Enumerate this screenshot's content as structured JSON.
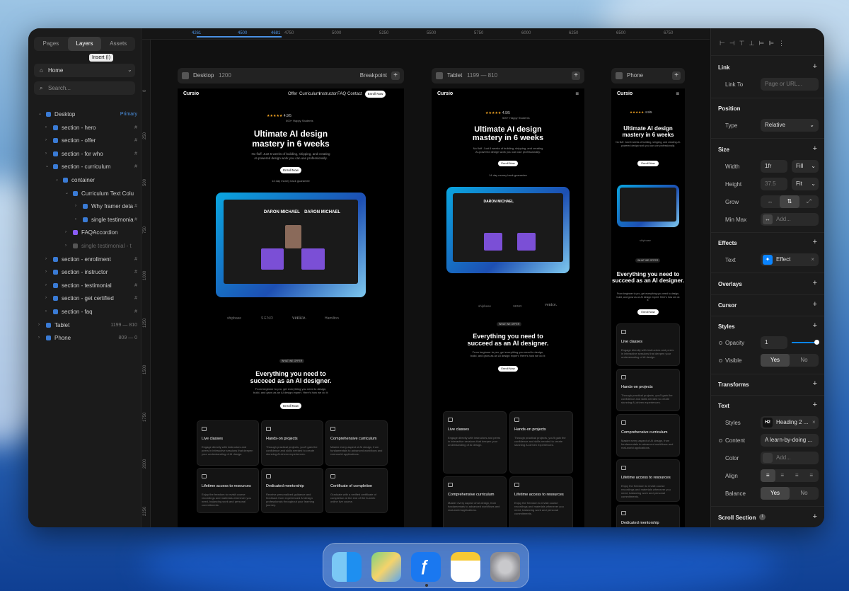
{
  "left_panel": {
    "tabs": [
      "Pages",
      "Layers",
      "Assets"
    ],
    "tooltip": "Insert (I)",
    "page_select": "Home",
    "search_placeholder": "Search...",
    "layers": [
      {
        "label": "Desktop",
        "right": "Primary",
        "depth": 0,
        "open": true
      },
      {
        "label": "section - hero",
        "right": "#",
        "depth": 1
      },
      {
        "label": "section - offer",
        "right": "#",
        "depth": 1
      },
      {
        "label": "section - for who",
        "right": "#",
        "depth": 1
      },
      {
        "label": "section - curriculum",
        "right": "#",
        "depth": 1,
        "open": true
      },
      {
        "label": "container",
        "right": "",
        "depth": 2,
        "open": true
      },
      {
        "label": "Curriculum Text Colu",
        "right": "",
        "depth": 3,
        "open": true
      },
      {
        "label": "Why framer deta",
        "right": "#",
        "depth": 4
      },
      {
        "label": "single testimonia",
        "right": "#",
        "depth": 4
      },
      {
        "label": "FAQAccordion",
        "right": "",
        "depth": 3
      },
      {
        "label": "single testimonial - t",
        "right": "",
        "depth": 3
      },
      {
        "label": "section - enrollment",
        "right": "#",
        "depth": 1
      },
      {
        "label": "section - instructor",
        "right": "#",
        "depth": 1
      },
      {
        "label": "section - testimonial",
        "right": "#",
        "depth": 1
      },
      {
        "label": "section - get certified",
        "right": "#",
        "depth": 1
      },
      {
        "label": "section - faq",
        "right": "#",
        "depth": 1
      },
      {
        "label": "Tablet",
        "right": "1199 — 810",
        "depth": 0
      },
      {
        "label": "Phone",
        "right": "809 — 0",
        "depth": 0
      }
    ]
  },
  "ruler": {
    "top": [
      "4261",
      "4500",
      "4681",
      "4750",
      "5000",
      "5250",
      "5500",
      "5750",
      "6000",
      "6250",
      "6500",
      "6750"
    ],
    "left": [
      "0",
      "250",
      "500",
      "750",
      "1000",
      "1250",
      "1500",
      "1750",
      "2000",
      "2250"
    ]
  },
  "frames": {
    "desktop": {
      "name": "Desktop",
      "width": "1200",
      "breakpoint": "Breakpoint"
    },
    "tablet": {
      "name": "Tablet",
      "range": "1199 — 810"
    },
    "phone": {
      "name": "Phone"
    }
  },
  "site": {
    "logo": "Cursio",
    "nav": [
      "Offer",
      "Curriculum",
      "Instructor",
      "FAQ",
      "Contact"
    ],
    "nav_cta": "Enroll Now",
    "rating": "4.9/5",
    "students": "500+ Happy Students",
    "hero_title_1": "Ultimate AI design",
    "hero_title_2": "mastery in 6 weeks",
    "hero_sub_1": "No fluff. Just 6 weeks of building, shipping, and creating",
    "hero_sub_2": "AI-powered design work you can use professionally.",
    "cta": "Enroll Now",
    "guarantee": "14 day money back guarantee",
    "mock_title": "DARON MICHAEL",
    "logos": [
      "shipbase",
      "SEND",
      "venice.",
      "Hamilton"
    ],
    "offer_badge": "WHAT WE OFFER",
    "offer_title_1": "Everything you need to",
    "offer_title_2": "succeed as an AI designer.",
    "offer_sub_1": "From beginner to pro, get everything you need to design,",
    "offer_sub_2": "build, and grow as an AI design expert. Here's how we do it:",
    "cards": [
      {
        "title": "Live classes",
        "desc": "Engage directly with instructors and peers in interactive sessions that deepen your understanding of AI design."
      },
      {
        "title": "Hands-on projects",
        "desc": "Through practical projects, you'll gain the confidence and skills needed to create stunning AI-driven experiences."
      },
      {
        "title": "Comprehensive curriculum",
        "desc": "Master every aspect of AI design, from fundamentals to advanced workflows and real-world applications."
      },
      {
        "title": "Lifetime access to resources",
        "desc": "Enjoy the freedom to revisit course recordings and materials whenever you need, balancing work and personal commitments."
      },
      {
        "title": "Dedicated mentorship",
        "desc": "Receive personalized guidance and feedback from experienced AI design professionals throughout your learning journey."
      },
      {
        "title": "Certificate of completion",
        "desc": "Graduate with a verified certificate of completion at the end of the 6-week online live course."
      }
    ]
  },
  "right_panel": {
    "link": {
      "title": "Link",
      "label": "Link To",
      "placeholder": "Page or URL..."
    },
    "position": {
      "title": "Position",
      "label": "Type",
      "value": "Relative"
    },
    "size": {
      "title": "Size",
      "width_label": "Width",
      "width_value": "1fr",
      "width_mode": "Fill",
      "height_label": "Height",
      "height_value": "37.5",
      "height_mode": "Fit",
      "grow_label": "Grow",
      "minmax_label": "Min Max",
      "minmax_value": "Add..."
    },
    "effects": {
      "title": "Effects",
      "label": "Text",
      "value": "Effect"
    },
    "overlays": "Overlays",
    "cursor": "Cursor",
    "styles": {
      "title": "Styles",
      "opacity_label": "Opacity",
      "opacity_value": "1",
      "visible_label": "Visible",
      "yes": "Yes",
      "no": "No"
    },
    "transforms": "Transforms",
    "text": {
      "title": "Text",
      "styles_label": "Styles",
      "styles_tag": "H2",
      "styles_value": "Heading 2 ...",
      "content_label": "Content",
      "content_value": "A learn-by-doing ...",
      "color_label": "Color",
      "color_value": "Add...",
      "align_label": "Align",
      "balance_label": "Balance",
      "yes": "Yes",
      "no": "No"
    },
    "scroll_section": "Scroll Section"
  },
  "dock": {
    "apps": [
      "finder-icon",
      "maps-icon",
      "framer-icon",
      "notes-icon",
      "settings-icon"
    ]
  }
}
